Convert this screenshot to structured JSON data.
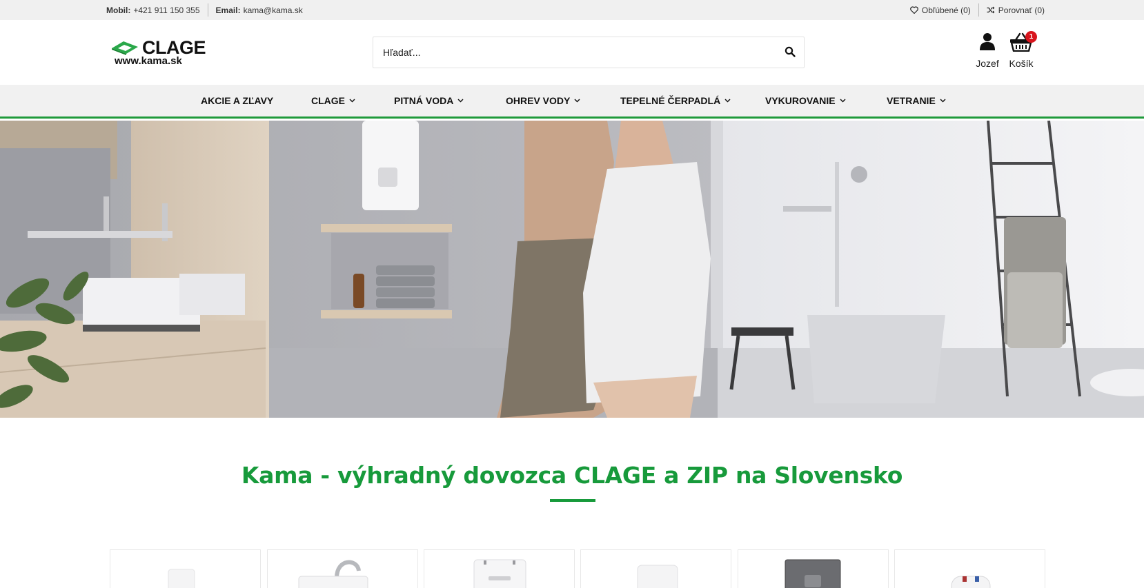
{
  "topbar": {
    "mobile_label": "Mobil:",
    "mobile_value": "+421 911 150 355",
    "email_label": "Email:",
    "email_value": "kama@kama.sk",
    "favorites": "Obľúbené (0)",
    "compare": "Porovnať (0)"
  },
  "header": {
    "logo_brand": "CLAGE",
    "logo_site": "www.kama.sk",
    "search_placeholder": "Hľadať...",
    "account_label": "Jozef",
    "cart_label": "Košík",
    "cart_count": "1"
  },
  "nav": {
    "items": [
      {
        "label": "AKCIE A ZĽAVY",
        "has_dropdown": false
      },
      {
        "label": "CLAGE",
        "has_dropdown": true
      },
      {
        "label": "PITNÁ VODA",
        "has_dropdown": true
      },
      {
        "label": "OHREV VODY",
        "has_dropdown": true
      },
      {
        "label": "TEPELNÉ ČERPADLÁ",
        "has_dropdown": true
      },
      {
        "label": "VYKUROVANIE",
        "has_dropdown": true
      },
      {
        "label": "VETRANIE",
        "has_dropdown": true
      }
    ]
  },
  "main": {
    "section_title": "Kama - výhradný dovozca CLAGE a ZIP na Slovensko"
  },
  "colors": {
    "brand_green": "#179a3b",
    "badge_red": "#d8151d",
    "topbar_bg": "#f0f0f0",
    "nav_bg": "#f1f1f1"
  },
  "icons": {
    "favorites": "heart-icon",
    "compare": "shuffle-icon",
    "search": "search-icon",
    "account": "user-icon",
    "cart": "basket-icon",
    "dropdown": "chevron-down-icon"
  }
}
